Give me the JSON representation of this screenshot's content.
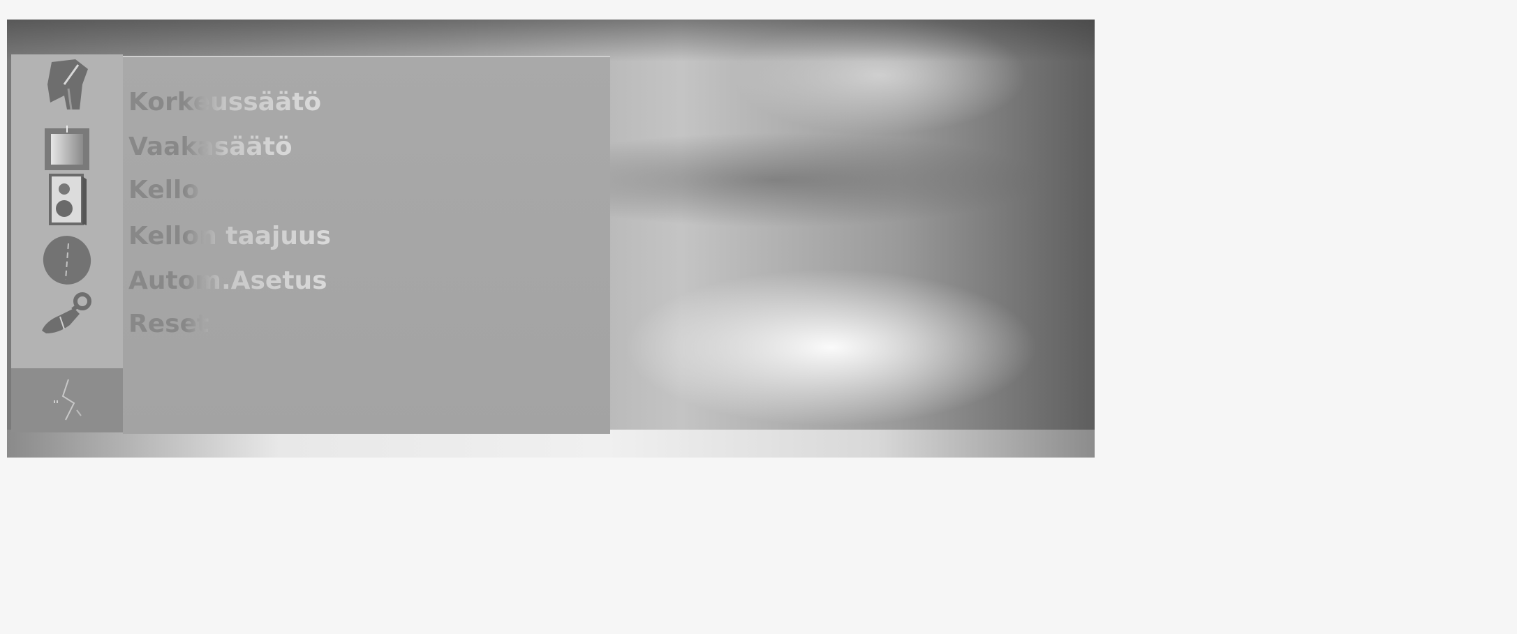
{
  "menu": {
    "items": [
      {
        "label": "Korkeussäätö"
      },
      {
        "label": "Vaakasäätö"
      },
      {
        "label": "Kello"
      },
      {
        "label": "Kellon taajuus"
      },
      {
        "label": "Autom.Asetus"
      },
      {
        "label": "Reset"
      }
    ]
  },
  "icons": [
    {
      "name": "satellite-dish-icon"
    },
    {
      "name": "picture-frame-icon"
    },
    {
      "name": "speaker-icon"
    },
    {
      "name": "clock-icon"
    },
    {
      "name": "key-icon"
    },
    {
      "name": "screen-adjust-icon"
    }
  ]
}
